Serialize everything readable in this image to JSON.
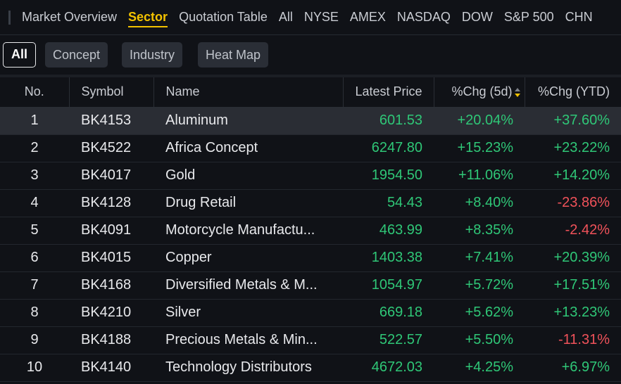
{
  "nav": {
    "items": [
      {
        "label": "Market Overview",
        "active": false
      },
      {
        "label": "Sector",
        "active": true
      },
      {
        "label": "Quotation Table",
        "active": false
      },
      {
        "label": "All",
        "active": false
      },
      {
        "label": "NYSE",
        "active": false
      },
      {
        "label": "AMEX",
        "active": false
      },
      {
        "label": "NASDAQ",
        "active": false
      },
      {
        "label": "DOW",
        "active": false
      },
      {
        "label": "S&P 500",
        "active": false
      },
      {
        "label": "CHN",
        "active": false
      }
    ]
  },
  "filters": {
    "all": "All",
    "concept": "Concept",
    "industry": "Industry",
    "heatmap": "Heat Map"
  },
  "table": {
    "headers": {
      "no": "No.",
      "symbol": "Symbol",
      "name": "Name",
      "price": "Latest Price",
      "chg5d": "%Chg (5d)",
      "ytd": "%Chg (YTD)"
    },
    "sort": {
      "column": "chg5d",
      "direction": "descending"
    },
    "selected_row": 1,
    "rows": [
      {
        "no": "1",
        "symbol": "BK4153",
        "name": "Aluminum",
        "price": "601.53",
        "chg5d": "+20.04%",
        "ytd": "+37.60%"
      },
      {
        "no": "2",
        "symbol": "BK4522",
        "name": "Africa Concept",
        "price": "6247.80",
        "chg5d": "+15.23%",
        "ytd": "+23.22%"
      },
      {
        "no": "3",
        "symbol": "BK4017",
        "name": "Gold",
        "price": "1954.50",
        "chg5d": "+11.06%",
        "ytd": "+14.20%"
      },
      {
        "no": "4",
        "symbol": "BK4128",
        "name": "Drug Retail",
        "price": "54.43",
        "chg5d": "+8.40%",
        "ytd": "-23.86%"
      },
      {
        "no": "5",
        "symbol": "BK4091",
        "name": "Motorcycle Manufactu...",
        "price": "463.99",
        "chg5d": "+8.35%",
        "ytd": "-2.42%"
      },
      {
        "no": "6",
        "symbol": "BK4015",
        "name": "Copper",
        "price": "1403.38",
        "chg5d": "+7.41%",
        "ytd": "+20.39%"
      },
      {
        "no": "7",
        "symbol": "BK4168",
        "name": "Diversified Metals & M...",
        "price": "1054.97",
        "chg5d": "+5.72%",
        "ytd": "+17.51%"
      },
      {
        "no": "8",
        "symbol": "BK4210",
        "name": "Silver",
        "price": "669.18",
        "chg5d": "+5.62%",
        "ytd": "+13.23%"
      },
      {
        "no": "9",
        "symbol": "BK4188",
        "name": "Precious Metals & Min...",
        "price": "522.57",
        "chg5d": "+5.50%",
        "ytd": "-11.31%"
      },
      {
        "no": "10",
        "symbol": "BK4140",
        "name": "Technology Distributors",
        "price": "4672.03",
        "chg5d": "+4.25%",
        "ytd": "+6.97%"
      }
    ]
  },
  "colors": {
    "background": "#101217",
    "accent": "#f3c200",
    "up": "#2fc777",
    "down": "#f0525a",
    "selected_row": "#2a2d34"
  },
  "icons": {
    "sort": "sort-descending-icon"
  }
}
